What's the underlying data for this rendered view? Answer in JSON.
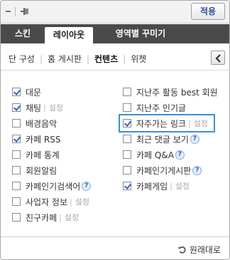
{
  "toolbar": {
    "apply_label": "적용"
  },
  "tabs": [
    {
      "label": "스킨"
    },
    {
      "label": "레이아웃",
      "active": true
    },
    {
      "label": "영역별 꾸미기"
    }
  ],
  "submenu": {
    "items": [
      {
        "label": "단 구성"
      },
      {
        "label": "홈 게시판"
      },
      {
        "label": "컨텐츠",
        "active": true
      },
      {
        "label": "위젯"
      }
    ]
  },
  "left_column": [
    {
      "label": "대문",
      "checked": true
    },
    {
      "label": "채팅",
      "checked": true,
      "setting": "설정"
    },
    {
      "label": "배경음악",
      "checked": false
    },
    {
      "label": "카페 RSS",
      "checked": true
    },
    {
      "label": "카페 통계",
      "checked": false
    },
    {
      "label": "회원알림",
      "checked": false
    },
    {
      "label": "카페인기검색어",
      "checked": false,
      "help": "?"
    },
    {
      "label": "사업자 정보",
      "checked": false,
      "setting": "설정"
    },
    {
      "label": "친구카페",
      "checked": false,
      "setting": "설정"
    }
  ],
  "right_column": [
    {
      "label": "지난주 활동 best 회원",
      "checked": false
    },
    {
      "label": "지난주 인기글",
      "checked": false
    },
    {
      "label": "자주가는 링크",
      "checked": true,
      "setting": "설정",
      "highlighted": true
    },
    {
      "label": "최근 댓글 보기",
      "checked": false,
      "help": "?"
    },
    {
      "label": "카페 Q&A",
      "checked": false,
      "help": "?"
    },
    {
      "label": "카페인기게시판",
      "checked": false,
      "help": "?"
    },
    {
      "label": "카페게임",
      "checked": true,
      "setting": "설정"
    }
  ],
  "footer": {
    "restore_label": "원래대로"
  },
  "colors": {
    "accent": "#2f62c0",
    "tab_bg": "#4a4a4a",
    "highlight": "#3c8fd6"
  }
}
